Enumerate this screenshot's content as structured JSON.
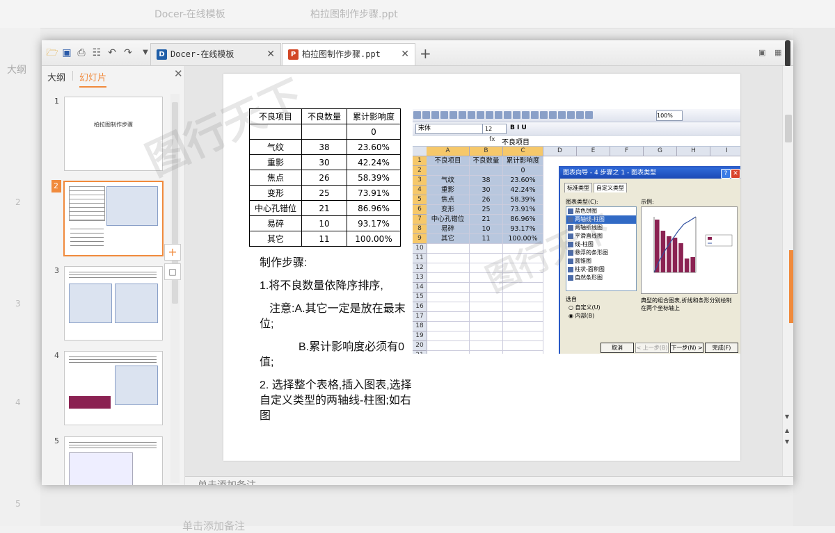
{
  "background": {
    "tab1": "Docer-在线模板",
    "tab2": "柏拉图制作步骤.ppt",
    "sidebar_label": "大纲",
    "notes": "单击添加备注",
    "slide_nums": [
      "2",
      "3",
      "4",
      "5"
    ]
  },
  "toolbar": {
    "open_icon": "folder-icon",
    "save_icon": "save-icon",
    "print_icon": "printer-icon",
    "preview_icon": "print-preview-icon",
    "undo_icon": "undo-icon",
    "redo_icon": "redo-icon"
  },
  "tabs": [
    {
      "label": "Docer-在线模板",
      "icon": "D",
      "color": "#1f5ea8"
    },
    {
      "label": "柏拉图制作步骤.ppt",
      "icon": "P",
      "color": "#d24726"
    }
  ],
  "sidebar": {
    "tab_outline": "大纲",
    "tab_slides": "幻灯片",
    "slide_numbers": [
      "1",
      "2",
      "3",
      "4",
      "5"
    ],
    "slide1_title": "柏拉图制作步骤"
  },
  "slide": {
    "table": {
      "headers": [
        "不良项目",
        "不良数量",
        "累计影响度"
      ],
      "rows": [
        [
          "",
          "",
          "0"
        ],
        [
          "气纹",
          "38",
          "23.60%"
        ],
        [
          "重影",
          "30",
          "42.24%"
        ],
        [
          "焦点",
          "26",
          "58.39%"
        ],
        [
          "变形",
          "25",
          "73.91%"
        ],
        [
          "中心孔错位",
          "21",
          "86.96%"
        ],
        [
          "易碎",
          "10",
          "93.17%"
        ],
        [
          "其它",
          "11",
          "100.00%"
        ]
      ]
    },
    "steps": {
      "heading": "制作步骤:",
      "step1": "1.将不良数量依降序排序,",
      "note_a": "注意:A.其它一定是放在最末位;",
      "note_b": "B.累计影响度必须有0值;",
      "step2": "2. 选择整个表格,插入图表,选择自定义类型的两轴线-柱图;如右图"
    },
    "excel": {
      "font_name": "宋体",
      "font_size": "12",
      "zoom": "100%",
      "formula_content": "不良项目",
      "columns": [
        "A",
        "B",
        "C",
        "D",
        "E",
        "F",
        "G",
        "H",
        "I"
      ],
      "rows": [
        "1",
        "2",
        "3",
        "4",
        "5",
        "6",
        "7",
        "8",
        "9",
        "10",
        "11",
        "12",
        "13",
        "14",
        "15",
        "16",
        "17",
        "18",
        "19",
        "20",
        "21"
      ],
      "cells": [
        [
          "不良项目",
          "不良数量",
          "累计影响度"
        ],
        [
          "",
          "",
          "0"
        ],
        [
          "气纹",
          "38",
          "23.60%"
        ],
        [
          "重影",
          "30",
          "42.24%"
        ],
        [
          "焦点",
          "26",
          "58.39%"
        ],
        [
          "变形",
          "25",
          "73.91%"
        ],
        [
          "中心孔错位",
          "21",
          "86.96%"
        ],
        [
          "易碎",
          "10",
          "93.17%"
        ],
        [
          "其它",
          "11",
          "100.00%"
        ]
      ],
      "dialog": {
        "title": "图表向导 - 4 步骤之 1 - 图表类型",
        "tab_standard": "标准类型",
        "tab_custom": "自定义类型",
        "list_label": "图表类型(C):",
        "sample_label": "示例:",
        "chart_types": [
          "蓝色饼图",
          "两轴线-柱图",
          "两轴折线图",
          "平滑直线图",
          "线-柱图",
          "悬浮的条形图",
          "圆锥图",
          "柱状-面积图",
          "自然条形图"
        ],
        "selected_index": 1,
        "select_from": "选自",
        "opt_user": "自定义(U)",
        "opt_builtin": "内部(B)",
        "description": "典型的组合图表,折线和条形分别绘制在两个坐标轴上",
        "btn_cancel": "取消",
        "btn_back": "< 上一步(B)",
        "btn_next": "下一步(N) >",
        "btn_finish": "完成(F)"
      }
    }
  },
  "notes_placeholder": "单击添加备注",
  "colors": {
    "accent": "#f08a3c",
    "bar": "#8b2252",
    "line": "#3050a0"
  }
}
